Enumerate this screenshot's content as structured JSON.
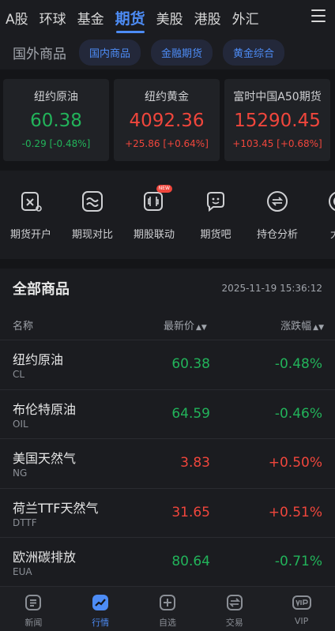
{
  "top_tabs": [
    {
      "label": "A股",
      "active": false
    },
    {
      "label": "环球",
      "active": false
    },
    {
      "label": "基金",
      "active": false
    },
    {
      "label": "期货",
      "active": true
    },
    {
      "label": "美股",
      "active": false
    },
    {
      "label": "港股",
      "active": false
    },
    {
      "label": "外汇",
      "active": false
    }
  ],
  "sub_nav": {
    "current": "国外商品",
    "pills": [
      "国内商品",
      "金融期货",
      "黄金综合"
    ]
  },
  "quote_cards": [
    {
      "name": "纽约原油",
      "price": "60.38",
      "change": "-0.29 [-0.48%]",
      "direction": "down"
    },
    {
      "name": "纽约黄金",
      "price": "4092.36",
      "change": "+25.86 [+0.64%]",
      "direction": "up"
    },
    {
      "name": "富时中国A50期货",
      "price": "15290.45",
      "change": "+103.45 [+0.68%]",
      "direction": "up"
    }
  ],
  "tools": [
    {
      "label": "期货开户",
      "icon": "account-open-icon"
    },
    {
      "label": "期现对比",
      "icon": "compare-icon"
    },
    {
      "label": "期股联动",
      "icon": "link-icon",
      "badge": "NEW"
    },
    {
      "label": "期货吧",
      "icon": "chat-icon"
    },
    {
      "label": "持仓分析",
      "icon": "position-analysis-icon"
    },
    {
      "label": "大V",
      "icon": "vip-target-icon"
    }
  ],
  "list": {
    "title": "全部商品",
    "timestamp": "2025-11-19 15:36:12",
    "columns": {
      "name": "名称",
      "price": "最新价",
      "change": "涨跌幅"
    },
    "rows": [
      {
        "name": "纽约原油",
        "code": "CL",
        "price": "60.38",
        "change": "-0.48%",
        "direction": "down"
      },
      {
        "name": "布伦特原油",
        "code": "OIL",
        "price": "64.59",
        "change": "-0.46%",
        "direction": "down"
      },
      {
        "name": "美国天然气",
        "code": "NG",
        "price": "3.83",
        "change": "+0.50%",
        "direction": "up"
      },
      {
        "name": "荷兰TTF天然气",
        "code": "DTTF",
        "price": "31.65",
        "change": "+0.51%",
        "direction": "up"
      },
      {
        "name": "欧洲碳排放",
        "code": "EUA",
        "price": "80.64",
        "change": "-0.71%",
        "direction": "down"
      }
    ]
  },
  "bottom_tabs": [
    {
      "label": "新闻",
      "icon": "news-icon",
      "active": false
    },
    {
      "label": "行情",
      "icon": "market-icon",
      "active": true
    },
    {
      "label": "自选",
      "icon": "watchlist-icon",
      "active": false
    },
    {
      "label": "交易",
      "icon": "trade-icon",
      "active": false
    },
    {
      "label": "VIP",
      "icon": "vip-icon",
      "active": false
    }
  ],
  "colors": {
    "accent": "#4d8cf5",
    "up": "#f0463c",
    "down": "#22b35a",
    "background": "#141518"
  }
}
